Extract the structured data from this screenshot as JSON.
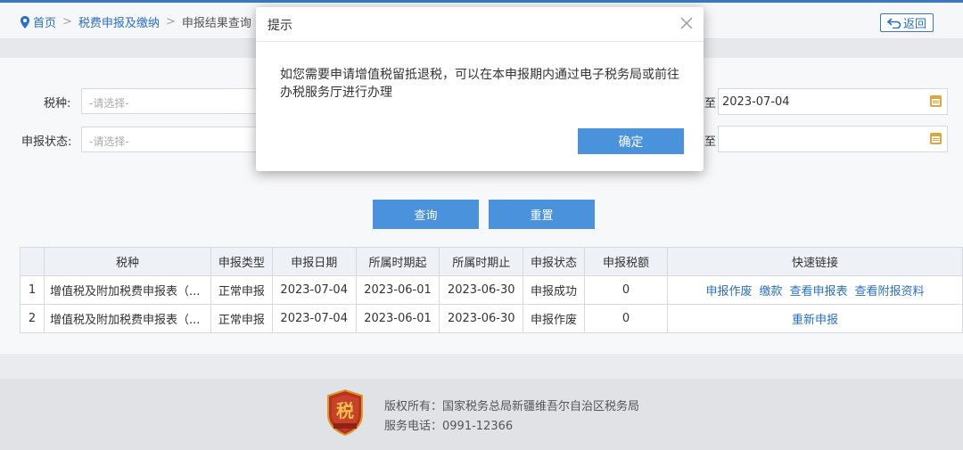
{
  "breadcrumb": {
    "home": "首页",
    "section": "税费申报及缴纳",
    "current": "申报结果查询",
    "back_label": "返回"
  },
  "filters": {
    "tax_type_label": "税种:",
    "tax_type_placeholder": "-请选择-",
    "status_label": "申报状态:",
    "status_placeholder": "-请选择-",
    "to_label": "至",
    "date_to_1": "2023-07-04",
    "date_to_2": ""
  },
  "buttons": {
    "query": "查询",
    "reset": "重置"
  },
  "table": {
    "headers": [
      "税种",
      "申报类型",
      "申报日期",
      "所属时期起",
      "所属时期止",
      "申报状态",
      "申报税额",
      "快速链接"
    ],
    "rows": [
      {
        "index": "1",
        "tax": "增值税及附加税费申报表（...",
        "type": "正常申报",
        "date": "2023-07-04",
        "period_start": "2023-06-01",
        "period_end": "2023-06-30",
        "status": "申报成功",
        "amount": "0",
        "links": [
          "申报作废",
          "缴款",
          "查看申报表",
          "查看附报资料"
        ]
      },
      {
        "index": "2",
        "tax": "增值税及附加税费申报表（...",
        "type": "正常申报",
        "date": "2023-07-04",
        "period_start": "2023-06-01",
        "period_end": "2023-06-30",
        "status": "申报作废",
        "amount": "0",
        "links": [
          "重新申报"
        ]
      }
    ]
  },
  "footer": {
    "copyright": "版权所有：国家税务总局新疆维吾尔自治区税务局",
    "phone": "服务电话：0991-12366",
    "logo_text": "税"
  },
  "dialog": {
    "title": "提示",
    "message": "如您需要申请增值税留抵退税，可以在本申报期内通过电子税务局或前往办税服务厅进行办理",
    "ok": "确定"
  },
  "colors": {
    "accent": "#4a92db",
    "link": "#2a6fc9"
  }
}
